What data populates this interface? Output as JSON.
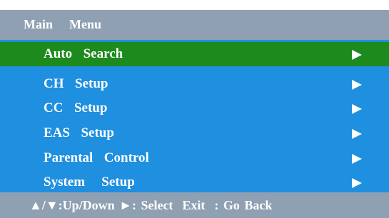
{
  "header": {
    "title": "Main  Menu"
  },
  "menu": {
    "items": [
      {
        "label": "Auto  Search",
        "selected": true,
        "icon": "arrow-right-icon"
      },
      {
        "label": "CH  Setup",
        "selected": false,
        "icon": "arrow-right-icon"
      },
      {
        "label": "CC  Setup",
        "selected": false,
        "icon": "arrow-right-icon"
      },
      {
        "label": "EAS  Setup",
        "selected": false,
        "icon": "arrow-right-icon"
      },
      {
        "label": "Parental  Control",
        "selected": false,
        "icon": "arrow-right-icon"
      },
      {
        "label": "System   Setup",
        "selected": false,
        "icon": "arrow-right-icon"
      }
    ]
  },
  "footer": {
    "hint": "▲/▼:Up/Down ►: Select  Exit  : Go Back"
  },
  "colors": {
    "menu_background": "#1f8fe0",
    "selected_row": "#1c8a1c",
    "title_bar": "#8fa0b2",
    "text": "#ffffff"
  }
}
